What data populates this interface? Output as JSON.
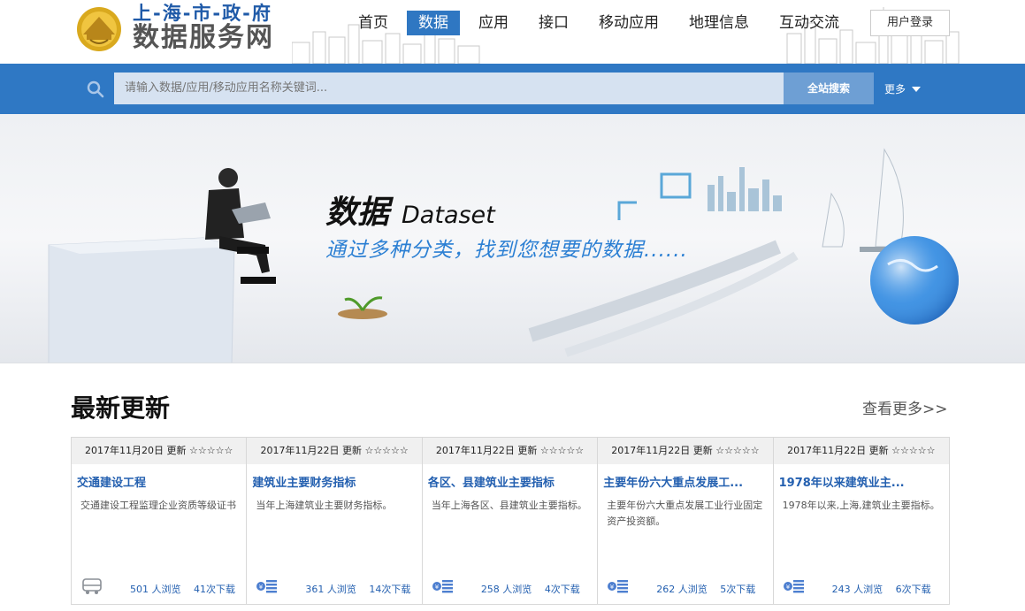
{
  "header": {
    "logo_top": "上-海-市-政-府",
    "logo_bottom": "数据服务网",
    "nav": [
      {
        "label": "首页",
        "active": false
      },
      {
        "label": "数据",
        "active": true
      },
      {
        "label": "应用",
        "active": false
      },
      {
        "label": "接口",
        "active": false
      },
      {
        "label": "移动应用",
        "active": false
      },
      {
        "label": "地理信息",
        "active": false
      },
      {
        "label": "互动交流",
        "active": false
      }
    ],
    "login_label": "用户登录"
  },
  "search": {
    "placeholder": "请输入数据/应用/移动应用名称关键词...",
    "button_label": "全站搜索",
    "more_label": "更多"
  },
  "banner": {
    "title_cn": "数据",
    "title_en": "Dataset",
    "subtitle": "通过多种分类，找到您想要的数据......"
  },
  "latest": {
    "title": "最新更新",
    "view_more": "查看更多>>",
    "cards": [
      {
        "date": "2017年11月20日",
        "update": "更新",
        "stars": "☆☆☆☆☆",
        "title": "交通建设工程",
        "desc": "交通建设工程监理企业资质等级证书",
        "views": "501 人浏览",
        "downloads": "41次下载",
        "icon": "bus-icon"
      },
      {
        "date": "2017年11月22日",
        "update": "更新",
        "stars": "☆☆☆☆☆",
        "title": "建筑业主要财务指标",
        "desc": "当年上海建筑业主要财务指标。",
        "views": "361 人浏览",
        "downloads": "14次下载",
        "icon": "finance-icon"
      },
      {
        "date": "2017年11月22日",
        "update": "更新",
        "stars": "☆☆☆☆☆",
        "title": "各区、县建筑业主要指标",
        "desc": "当年上海各区、县建筑业主要指标。",
        "views": "258 人浏览",
        "downloads": "4次下载",
        "icon": "finance-icon"
      },
      {
        "date": "2017年11月22日",
        "update": "更新",
        "stars": "☆☆☆☆☆",
        "title": "主要年份六大重点发展工...",
        "desc": "主要年份六大重点发展工业行业固定资产投资额。",
        "views": "262 人浏览",
        "downloads": "5次下载",
        "icon": "finance-icon"
      },
      {
        "date": "2017年11月22日",
        "update": "更新",
        "stars": "☆☆☆☆☆",
        "title": "1978年以来建筑业主...",
        "desc": "1978年以来,上海,建筑业主要指标。",
        "views": "243 人浏览",
        "downloads": "6次下载",
        "icon": "finance-icon"
      }
    ]
  },
  "colors": {
    "brand_blue": "#2f78c4",
    "link_blue": "#2460b0",
    "logo_gold": "#d9a91e"
  }
}
